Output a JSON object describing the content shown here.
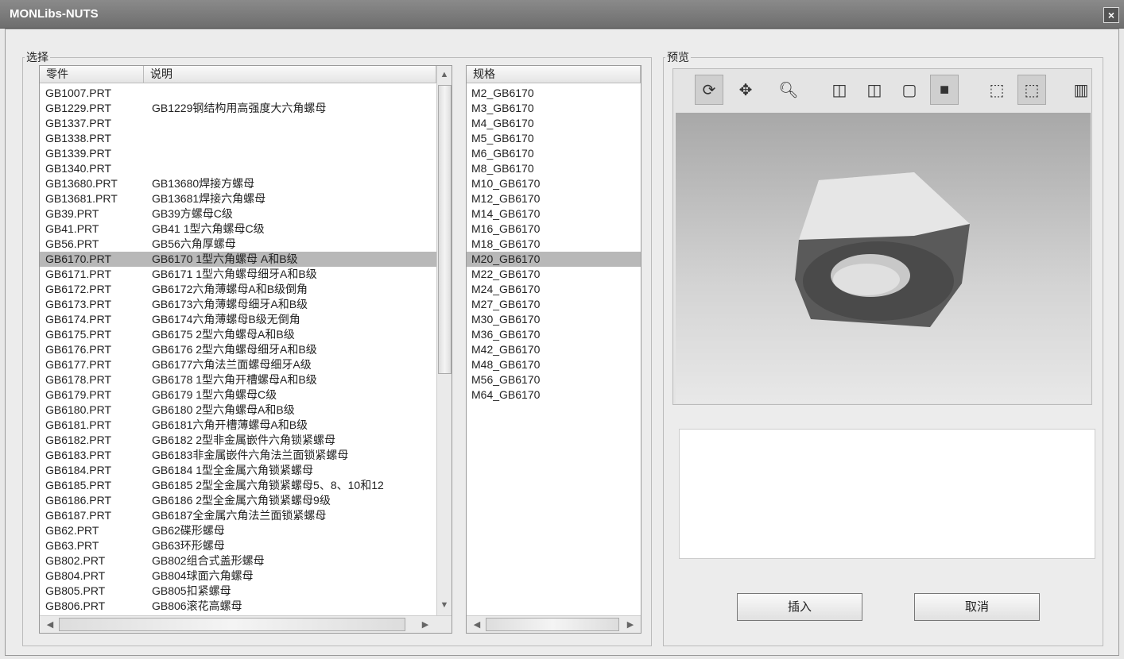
{
  "window": {
    "title": "MONLibs-NUTS",
    "close_label": "×"
  },
  "select_group": {
    "legend": "选择",
    "columns": [
      "零件",
      "说明"
    ],
    "rows": [
      [
        "GB1007.PRT",
        ""
      ],
      [
        "GB1229.PRT",
        "GB1229钢结构用高强度大六角螺母"
      ],
      [
        "GB1337.PRT",
        ""
      ],
      [
        "GB1338.PRT",
        ""
      ],
      [
        "GB1339.PRT",
        ""
      ],
      [
        "GB1340.PRT",
        ""
      ],
      [
        "GB13680.PRT",
        "GB13680焊接方螺母"
      ],
      [
        "GB13681.PRT",
        "GB13681焊接六角螺母"
      ],
      [
        "GB39.PRT",
        "GB39方螺母C级"
      ],
      [
        "GB41.PRT",
        "GB41  1型六角螺母C级"
      ],
      [
        "GB56.PRT",
        "GB56六角厚螺母"
      ],
      [
        "GB6170.PRT",
        "GB6170  1型六角螺母  A和B级"
      ],
      [
        "GB6171.PRT",
        "GB6171  1型六角螺母细牙A和B级"
      ],
      [
        "GB6172.PRT",
        "GB6172六角薄螺母A和B级倒角"
      ],
      [
        "GB6173.PRT",
        "GB6173六角薄螺母细牙A和B级"
      ],
      [
        "GB6174.PRT",
        "GB6174六角薄螺母B级无倒角"
      ],
      [
        "GB6175.PRT",
        "GB6175  2型六角螺母A和B级"
      ],
      [
        "GB6176.PRT",
        "GB6176  2型六角螺母细牙A和B级"
      ],
      [
        "GB6177.PRT",
        "GB6177六角法兰面螺母细牙A级"
      ],
      [
        "GB6178.PRT",
        "GB6178  1型六角开槽螺母A和B级"
      ],
      [
        "GB6179.PRT",
        "GB6179  1型六角螺母C级"
      ],
      [
        "GB6180.PRT",
        "GB6180  2型六角螺母A和B级"
      ],
      [
        "GB6181.PRT",
        "GB6181六角开槽薄螺母A和B级"
      ],
      [
        "GB6182.PRT",
        "GB6182  2型非金属嵌件六角锁紧螺母"
      ],
      [
        "GB6183.PRT",
        "GB6183非金属嵌件六角法兰面锁紧螺母"
      ],
      [
        "GB6184.PRT",
        "GB6184  1型全金属六角锁紧螺母"
      ],
      [
        "GB6185.PRT",
        "GB6185  2型全金属六角锁紧螺母5、8、10和12"
      ],
      [
        "GB6186.PRT",
        "GB6186  2型全金属六角锁紧螺母9级"
      ],
      [
        "GB6187.PRT",
        "GB6187全金属六角法兰面锁紧螺母"
      ],
      [
        "GB62.PRT",
        "GB62碟形螺母"
      ],
      [
        "GB63.PRT",
        "GB63环形螺母"
      ],
      [
        "GB802.PRT",
        "GB802组合式盖形螺母"
      ],
      [
        "GB804.PRT",
        "GB804球面六角螺母"
      ],
      [
        "GB805.PRT",
        "GB805扣紧螺母"
      ],
      [
        "GB806.PRT",
        "GB806滚花高螺母"
      ]
    ],
    "selected_index": 11
  },
  "spec_list": {
    "header": "规格",
    "items": [
      "M2_GB6170",
      "M3_GB6170",
      "M4_GB6170",
      "M5_GB6170",
      "M6_GB6170",
      "M8_GB6170",
      "M10_GB6170",
      "M12_GB6170",
      "M14_GB6170",
      "M16_GB6170",
      "M18_GB6170",
      "M20_GB6170",
      "M22_GB6170",
      "M24_GB6170",
      "M27_GB6170",
      "M30_GB6170",
      "M36_GB6170",
      "M42_GB6170",
      "M48_GB6170",
      "M56_GB6170",
      "M64_GB6170"
    ],
    "selected_index": 11
  },
  "preview_group": {
    "legend": "预览",
    "description": ""
  },
  "buttons": {
    "insert": "插入",
    "cancel": "取消"
  }
}
